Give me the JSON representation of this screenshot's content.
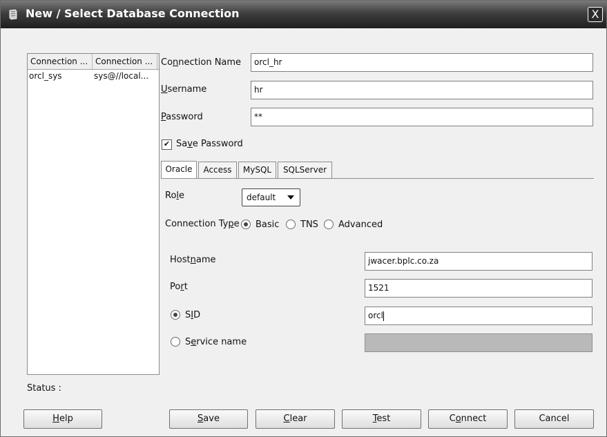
{
  "window": {
    "title": "New / Select Database Connection",
    "close_label": "X"
  },
  "connections_list": {
    "columns": [
      "Connection ...",
      "Connection ..."
    ],
    "rows": [
      [
        "orcl_sys",
        "sys@//local..."
      ]
    ]
  },
  "form": {
    "connection_name": {
      "label_pre": "Co",
      "label_ul": "n",
      "label_post": "nection Name",
      "value": "orcl_hr"
    },
    "username": {
      "label_pre": "",
      "label_ul": "U",
      "label_post": "sername",
      "value": "hr"
    },
    "password": {
      "label_pre": "",
      "label_ul": "P",
      "label_post": "assword",
      "value": "**"
    },
    "save_password": {
      "label_pre": "Sa",
      "label_ul": "v",
      "label_post": "e Password",
      "checked": true,
      "check_glyph": "✔"
    }
  },
  "tabs": [
    "Oracle",
    "Access",
    "MySQL",
    "SQLServer"
  ],
  "oracle": {
    "role": {
      "label_pre": "Ro",
      "label_ul": "l",
      "label_post": "e",
      "value": "default"
    },
    "connection_type": {
      "label_pre": "Connection Ty",
      "label_ul": "p",
      "label_post": "e",
      "options": [
        "Basic",
        "TNS",
        "Advanced"
      ],
      "selected": "Basic"
    },
    "hostname": {
      "label_pre": "Host",
      "label_ul": "n",
      "label_post": "ame",
      "value": "jwacer.bplc.co.za"
    },
    "port": {
      "label_pre": "Po",
      "label_ul": "r",
      "label_post": "t",
      "value": "1521"
    },
    "sid": {
      "label_pre": "S",
      "label_ul": "I",
      "label_post": "D",
      "value": "orcl",
      "selected": true
    },
    "service_name": {
      "label_pre": "S",
      "label_ul": "e",
      "label_post": "rvice name",
      "value": "",
      "selected": false
    }
  },
  "status": {
    "label": "Status :"
  },
  "buttons": {
    "help": {
      "pre": "",
      "ul": "H",
      "post": "elp"
    },
    "save": {
      "pre": "",
      "ul": "S",
      "post": "ave"
    },
    "clear": {
      "pre": "",
      "ul": "C",
      "post": "lear"
    },
    "test": {
      "pre": "",
      "ul": "T",
      "post": "est"
    },
    "connect": {
      "pre": "C",
      "ul": "o",
      "post": "nnect"
    },
    "cancel": {
      "pre": "Cancel",
      "ul": "",
      "post": ""
    }
  }
}
